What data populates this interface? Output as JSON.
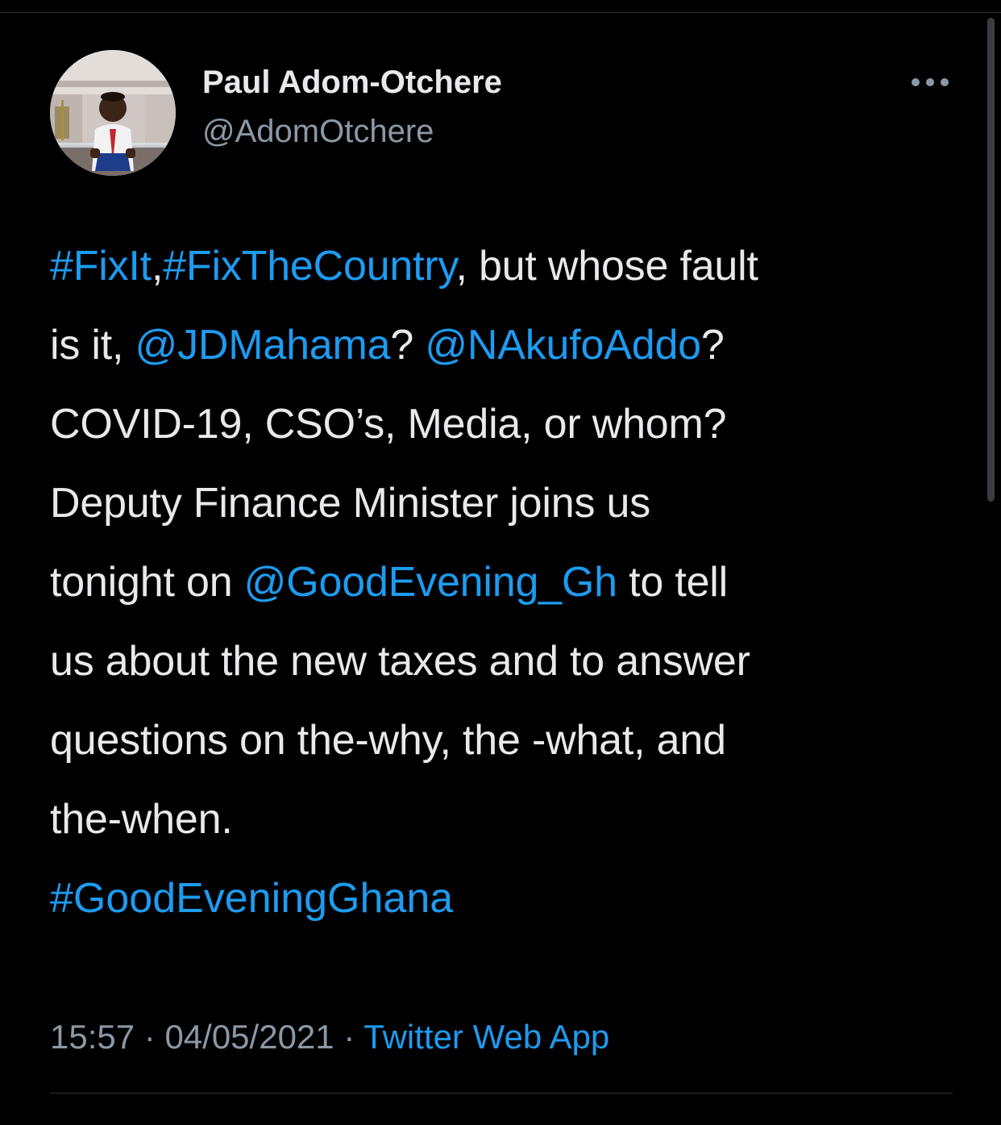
{
  "user": {
    "display_name": "Paul Adom-Otchere",
    "handle": "@AdomOtchere",
    "avatar_icon": "profile-photo"
  },
  "menu": {
    "more_icon": "more-dots-icon"
  },
  "tweet": {
    "line1": {
      "tag1": "#FixIt",
      "sep1": ",",
      "tag2": "#FixTheCountry",
      "rest": ", but whose fault"
    },
    "line2": {
      "pre": "is it, ",
      "mention1": "@JDMahama",
      "mid": "? ",
      "mention2": "@NAkufoAddo",
      "post": "?"
    },
    "line3": "COVID-19, CSO’s, Media, or whom?",
    "line4": "Deputy Finance Minister joins us",
    "line5": {
      "pre": "tonight on ",
      "mention": "@GoodEvening_Gh",
      "post": " to tell"
    },
    "line6": "us about the new taxes and to answer",
    "line7": "questions on the-why, the -what, and",
    "line8": "the-when.",
    "footer_hashtag": "#GoodEveningGhana"
  },
  "meta": {
    "time": "15:57",
    "sep1": " · ",
    "date": "04/05/2021",
    "sep2": " · ",
    "source": "Twitter Web App"
  },
  "colors": {
    "background": "#000000",
    "text": "#e7e9ea",
    "secondary": "#8b98a5",
    "link": "#1d9bf0"
  }
}
